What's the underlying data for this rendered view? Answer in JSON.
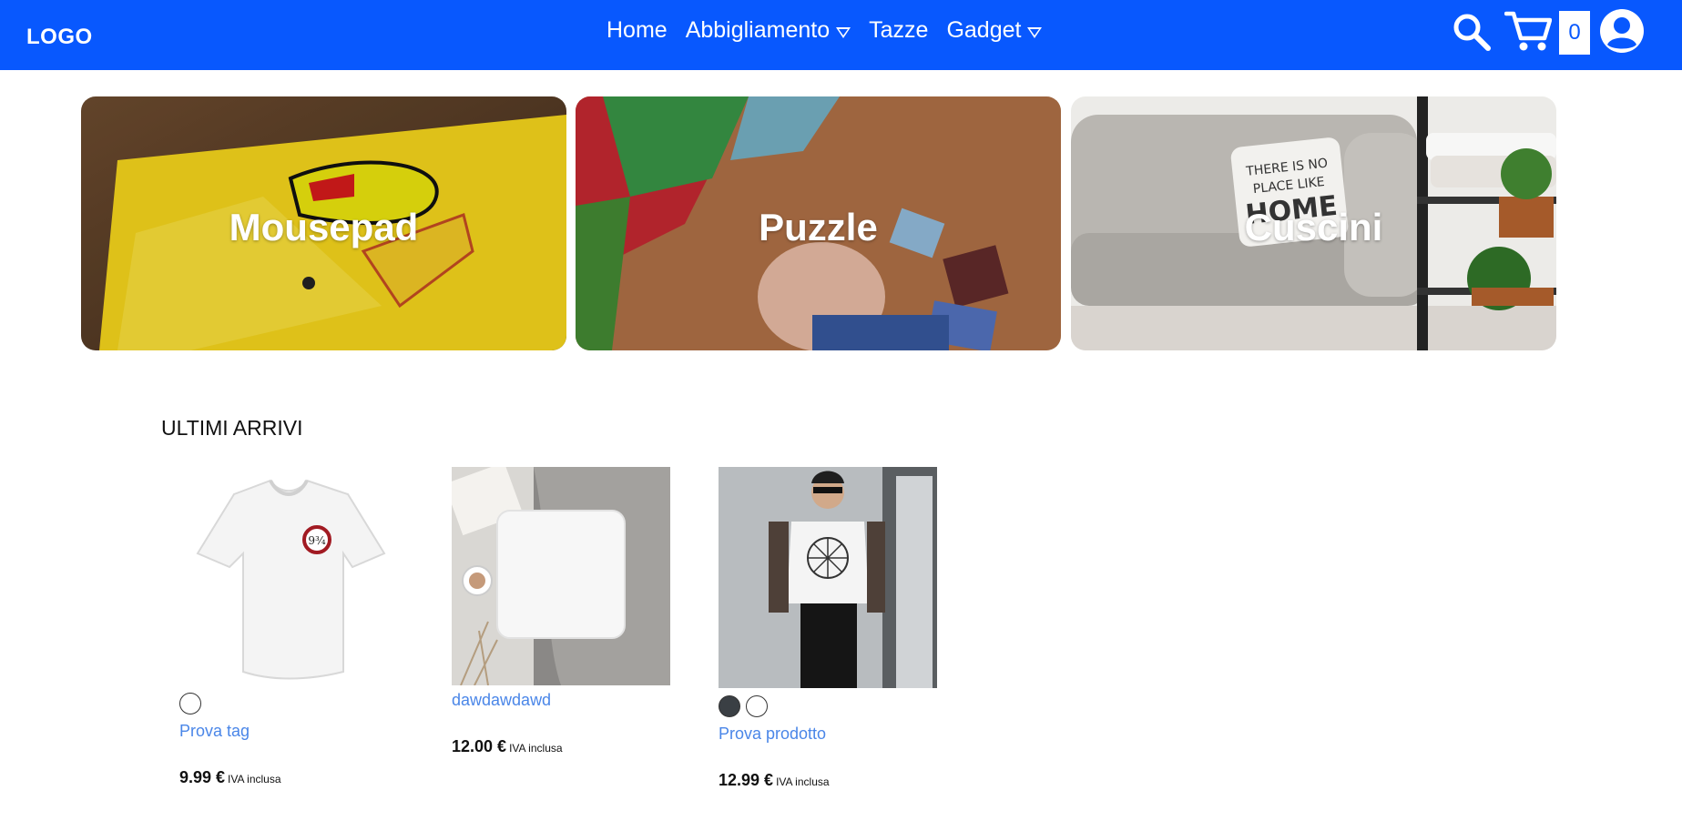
{
  "header": {
    "logo": "LOGO",
    "nav": [
      {
        "label": "Home",
        "dropdown": false
      },
      {
        "label": "Abbigliamento",
        "dropdown": true
      },
      {
        "label": "Tazze",
        "dropdown": false
      },
      {
        "label": "Gadget",
        "dropdown": true
      }
    ],
    "cart_count": "0",
    "icons": [
      "search-icon",
      "cart-icon",
      "user-icon"
    ],
    "bg_color": "#0858fe"
  },
  "categories": [
    {
      "label": "Mousepad"
    },
    {
      "label": "Puzzle"
    },
    {
      "label": "Cuscini"
    }
  ],
  "section": {
    "title": "ULTIMI ARRIVI"
  },
  "products": [
    {
      "name": "Prova tag",
      "price": "9.99 €",
      "iva": "IVA inclusa",
      "swatches": [
        "#ffffff"
      ]
    },
    {
      "name": "dawdawdawd",
      "price": "12.00 €",
      "iva": "IVA inclusa",
      "swatches": []
    },
    {
      "name": "Prova prodotto",
      "price": "12.99 €",
      "iva": "IVA inclusa",
      "swatches": [
        "#3a3f44",
        "#ffffff"
      ]
    }
  ],
  "colors": {
    "accent": "#0858fe",
    "link": "#4a86e8"
  }
}
